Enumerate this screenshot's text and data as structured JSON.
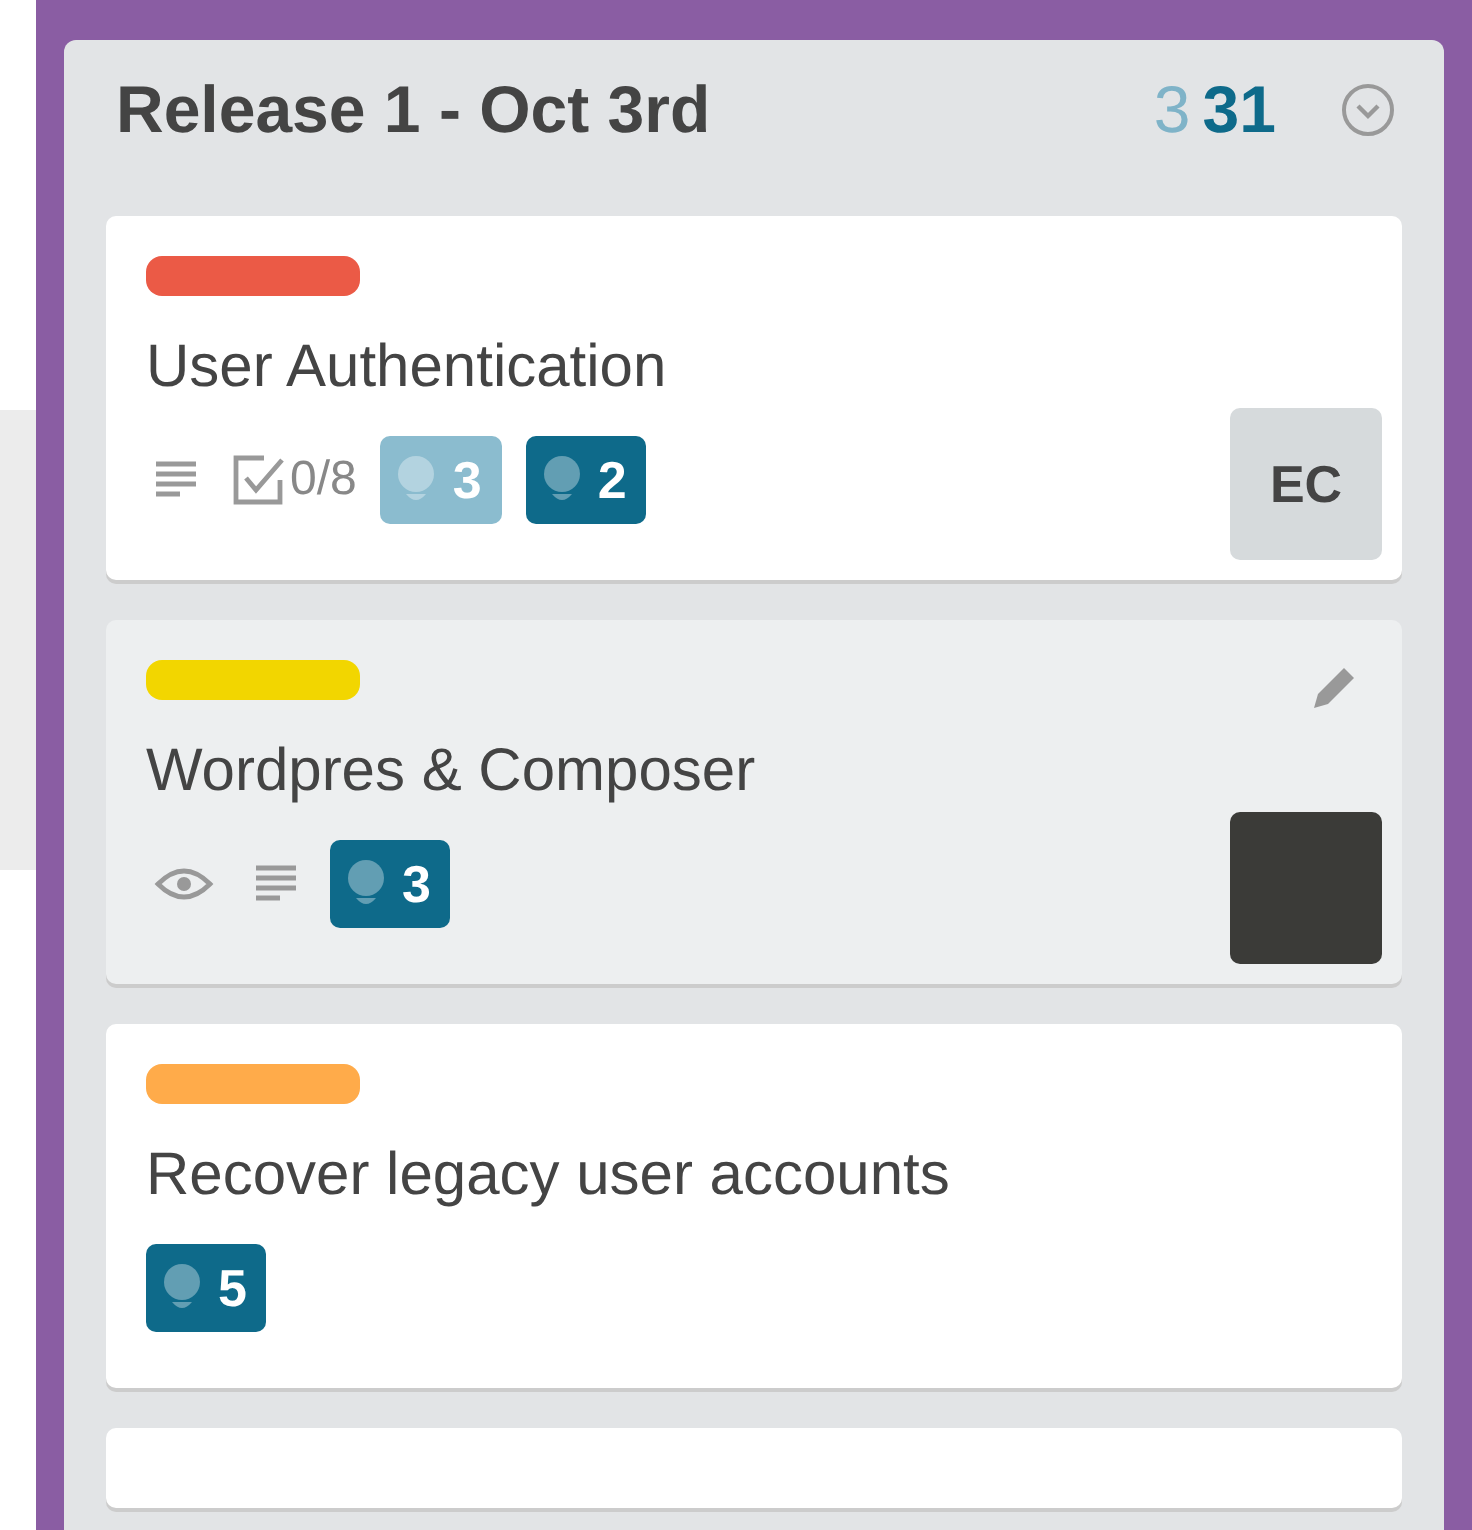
{
  "list": {
    "title": "Release 1 - Oct 3rd",
    "counts": [
      {
        "text": "3",
        "kind": "light"
      },
      {
        "text": "31",
        "kind": "dark"
      }
    ]
  },
  "cards": [
    {
      "color": "#eb5a46",
      "title": "User Authentication",
      "hovered": false,
      "badges": [
        {
          "kind": "description"
        },
        {
          "kind": "checklist",
          "text": "0/8"
        },
        {
          "kind": "votes-light",
          "text": "3"
        },
        {
          "kind": "votes-dark",
          "text": "2"
        }
      ],
      "member": {
        "kind": "initials",
        "text": "EC"
      }
    },
    {
      "color": "#f2d600",
      "title": "Wordpres & Composer",
      "hovered": true,
      "badges": [
        {
          "kind": "watch"
        },
        {
          "kind": "description"
        },
        {
          "kind": "votes-dark",
          "text": "3"
        }
      ],
      "member": {
        "kind": "photo"
      }
    },
    {
      "color": "#ffab4a",
      "title": "Recover legacy user accounts",
      "hovered": false,
      "badges": [
        {
          "kind": "votes-dark",
          "text": "5"
        }
      ]
    }
  ],
  "next_card_partial": true
}
